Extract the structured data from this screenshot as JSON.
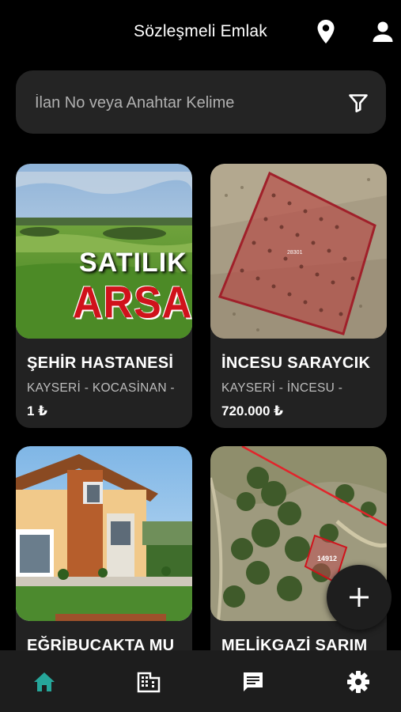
{
  "header": {
    "title": "Sözleşmeli Emlak"
  },
  "search": {
    "placeholder": "İlan No veya Anahtar Kelime"
  },
  "listings": [
    {
      "title": "ŞEHİR HASTANESİ",
      "location": "KAYSERİ - KOCASİNAN -",
      "price": "1 ₺",
      "image_text": [
        "SATILIK",
        "ARSA"
      ]
    },
    {
      "title": "İNCESU SARAYCIK",
      "location": "KAYSERİ - İNCESU -",
      "price": "720.000 ₺",
      "image_text": [
        "28301"
      ]
    },
    {
      "title": "EĞRİBUCAKTA MU",
      "location": "",
      "price": ""
    },
    {
      "title": "MELİKGAZİ SARIM",
      "location": "",
      "price": "",
      "image_text": [
        "14912"
      ]
    }
  ],
  "fab": {
    "icon": "plus-icon"
  },
  "bottom_nav": [
    {
      "icon": "home-icon",
      "active": true,
      "color": "#26a69a"
    },
    {
      "icon": "building-icon",
      "active": false
    },
    {
      "icon": "message-icon",
      "active": false
    },
    {
      "icon": "settings-icon",
      "active": false
    }
  ],
  "colors": {
    "background": "#000000",
    "surface": "#242424",
    "accent": "#26a69a",
    "sale_red": "#d0121b"
  }
}
